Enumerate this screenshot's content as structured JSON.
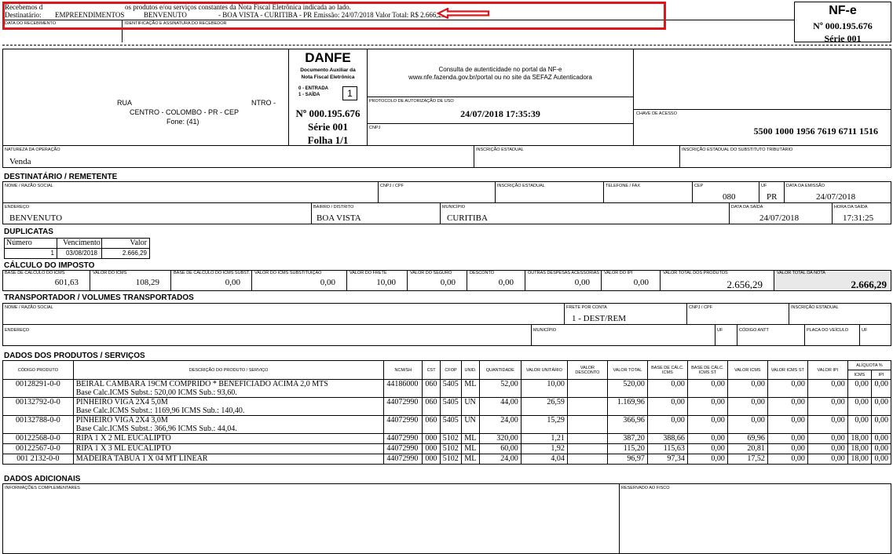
{
  "canhoto": {
    "line1_left": "Recebemos d",
    "line1_right": "os produtos e/ou serviços constantes da Nota Fiscal Eletrônica indicada ao lado.",
    "dest_label": "Destinatário:",
    "dest_name": "EMPREENDIMENTOS",
    "dest_addr": "BENVENUTO",
    "dest_rest": "- BOA VISTA - CURITIBA - PR Emissão: 24/07/2018  Valor Total: R$ 2.666,29",
    "date_label": "DATA DO RECEBIMENTO",
    "sign_label": "IDENTIFICAÇÃO E ASSINATURA DO RECEBEDOR",
    "nfe_title": "NF-e",
    "nfe_number": "Nº 000.195.676",
    "nfe_serie": "Série 001",
    "highlight_color": "#e0151b"
  },
  "emitente": {
    "street": "RUA",
    "district_code": "NTRO -",
    "city_line": "CENTRO - COLOMBO - PR - CEP",
    "phone": "Fone: (41)"
  },
  "danfe": {
    "title": "DANFE",
    "sub1": "Documento Auxiliar da",
    "sub2": "Nota Fiscal Eletrônica",
    "entrada": "0 - ENTRADA",
    "saida": "1 - SAÍDA",
    "tipo": "1",
    "numero": "Nº 000.195.676",
    "serie": "Série 001",
    "folha": "Folha 1/1"
  },
  "consulta": {
    "line1": "Consulta de autenticidade no portal da NF-e",
    "line2": "www.nfe.fazenda.gov.br/portal ou no site da SEFAZ Autenticadora",
    "protocolo_label": "PROTOCOLO DE AUTORIZAÇÃO DE USO",
    "protocolo_value": "24/07/2018 17:35:39",
    "cnpj_label": "CNPJ",
    "chave_label": "CHAVE DE ACESSO",
    "chave_value": "5500 1000 1956 7619 6711 1516"
  },
  "natureza": {
    "label": "NATUREZA DA OPERAÇÃO",
    "value": "Venda",
    "ie_label": "INSCRIÇÃO ESTADUAL",
    "ie_st_label": "INSCRIÇÃO ESTADUAL DO SUBSTITUTO TRIBUTÁRIO"
  },
  "destinatario": {
    "section": "DESTINATÁRIO / REMETENTE",
    "nome_label": "NOME / RAZÃO SOCIAL",
    "cnpj_label": "CNPJ / CPF",
    "ie_label": "INSCRIÇÃO ESTADUAL",
    "fone_label": "TELEFONE / FAX",
    "cep_label": "CEP",
    "cep_value": "080",
    "uf_label": "UF",
    "uf_value": "PR",
    "emissao_label": "DATA DA EMISSÃO",
    "emissao_value": "24/07/2018",
    "endereco_label": "ENDEREÇO",
    "endereco_value": "BENVENUTO",
    "bairro_label": "BAIRRO / DISTRITO",
    "bairro_value": "BOA VISTA",
    "municipio_label": "MUNICÍPIO",
    "municipio_value": "CURITIBA",
    "saida_label": "DATA DA SAÍDA",
    "saida_value": "24/07/2018",
    "hora_label": "HORA DA SAÍDA",
    "hora_value": "17:31:25"
  },
  "duplicatas": {
    "section": "DUPLICATAS",
    "headers": [
      "Número",
      "Vencimento",
      "Valor"
    ],
    "row": [
      "1",
      "03/08/2018",
      "2.666,29"
    ]
  },
  "imposto": {
    "section": "CÁLCULO DO IMPOSTO",
    "fields": [
      {
        "label": "BASE DE CÁLCULO DO ICMS",
        "value": "601,63"
      },
      {
        "label": "VALOR DO ICMS",
        "value": "108,29"
      },
      {
        "label": "BASE DE CÁLCULO DO ICMS SUBST.",
        "value": "0,00"
      },
      {
        "label": "VALOR DO ICMS SUBSTITUIÇÃO",
        "value": "0,00"
      },
      {
        "label": "VALOR DO FRETE",
        "value": "10,00"
      },
      {
        "label": "VALOR DO SEGURO",
        "value": "0,00"
      },
      {
        "label": "DESCONTO",
        "value": "0,00"
      },
      {
        "label": "OUTRAS DESPESAS ACESSÓRIAS",
        "value": "0,00"
      },
      {
        "label": "VALOR DO IPI",
        "value": "0,00"
      },
      {
        "label": "VALOR TOTAL DOS PRODUTOS",
        "value": "2.656,29"
      },
      {
        "label": "VALOR TOTAL DA NOTA",
        "value": "2.666,29"
      }
    ]
  },
  "transportador": {
    "section": "TRANSPORTADOR / VOLUMES TRANSPORTADOS",
    "nome_label": "NOME / RAZÃO SOCIAL",
    "frete_label": "FRETE POR CONTA",
    "frete_value": "1 - DEST/REM",
    "cnpj_label": "CNPJ / CPF",
    "ie_label": "INSCRIÇÃO ESTADUAL",
    "endereco_label": "ENDEREÇO",
    "municipio_label": "MUNICÍPIO",
    "uf_label": "UF",
    "antt_label": "CÓDIGO ANTT",
    "placa_label": "PLACA DO VEÍCULO",
    "uf2_label": "UF"
  },
  "produtos": {
    "section": "DADOS DOS PRODUTOS / SERVIÇOS",
    "headers": [
      "CÓDIGO PRODUTO",
      "DESCRIÇÃO DO PRODUTO / SERVIÇO",
      "NCM/SH",
      "CST",
      "CFOP",
      "UNID.",
      "QUANTIDADE",
      "VALOR UNITÁRIO",
      "VALOR DESCONTO",
      "VALOR TOTAL",
      "BASE DE CÁLC. ICMS",
      "BASE DE CÁLC. ICMS ST",
      "VALOR ICMS",
      "VALOR ICMS ST",
      "VALOR IPI"
    ],
    "aliquota_label": "ALÍQUOTA %",
    "aliquota_icms": "ICMS",
    "aliquota_ipi": "IPI",
    "rows": [
      {
        "codigo": "00128291-0-0",
        "descricao": "BEIRAL CAMBARA 19CM COMPRIDO * BENEFICIADO ACIMA 2,0 MTS",
        "extra": "Base Calc.ICMS Subst.: 520,00 ICMS Sub.: 93,60.",
        "ncm": "44186000",
        "cst": "060",
        "cfop": "5405",
        "unid": "ML",
        "qtd": "52,00",
        "vunit": "10,00",
        "vdesc": "",
        "vtotal": "520,00",
        "bc": "0,00",
        "bcst": "0,00",
        "vicms": "0,00",
        "vicmsst": "0,00",
        "vipi": "0,00",
        "aicms": "0,00",
        "aipi": "0,00"
      },
      {
        "codigo": "00132792-0-0",
        "descricao": "PINHEIRO VIGA 2X4 5,0M",
        "extra": "Base Calc.ICMS Subst.: 1169,96 ICMS Sub.: 140,40.",
        "ncm": "44072990",
        "cst": "060",
        "cfop": "5405",
        "unid": "UN",
        "qtd": "44,00",
        "vunit": "26,59",
        "vdesc": "",
        "vtotal": "1.169,96",
        "bc": "0,00",
        "bcst": "0,00",
        "vicms": "0,00",
        "vicmsst": "0,00",
        "vipi": "0,00",
        "aicms": "0,00",
        "aipi": "0,00"
      },
      {
        "codigo": "00132788-0-0",
        "descricao": "PINHEIRO VIGA 2X4 3,0M",
        "extra": "Base Calc.ICMS Subst.: 366,96 ICMS Sub.: 44,04.",
        "ncm": "44072990",
        "cst": "060",
        "cfop": "5405",
        "unid": "UN",
        "qtd": "24,00",
        "vunit": "15,29",
        "vdesc": "",
        "vtotal": "366,96",
        "bc": "0,00",
        "bcst": "0,00",
        "vicms": "0,00",
        "vicmsst": "0,00",
        "vipi": "0,00",
        "aicms": "0,00",
        "aipi": "0,00"
      },
      {
        "codigo": "00122568-0-0",
        "descricao": "RIPA 1 X 2 ML EUCALIPTO",
        "extra": "",
        "ncm": "44072990",
        "cst": "000",
        "cfop": "5102",
        "unid": "ML",
        "qtd": "320,00",
        "vunit": "1,21",
        "vdesc": "",
        "vtotal": "387,20",
        "bc": "388,66",
        "bcst": "0,00",
        "vicms": "69,96",
        "vicmsst": "0,00",
        "vipi": "0,00",
        "aicms": "18,00",
        "aipi": "0,00"
      },
      {
        "codigo": "00122567-0-0",
        "descricao": "RIPA 1 X 3 ML EUCALIPTO",
        "extra": "",
        "ncm": "44072990",
        "cst": "000",
        "cfop": "5102",
        "unid": "ML",
        "qtd": "60,00",
        "vunit": "1,92",
        "vdesc": "",
        "vtotal": "115,20",
        "bc": "115,63",
        "bcst": "0,00",
        "vicms": "20,81",
        "vicmsst": "0,00",
        "vipi": "0,00",
        "aicms": "18,00",
        "aipi": "0,00"
      },
      {
        "codigo": "001 2132-0-0",
        "descricao": "MADEIRA TABUA 1 X 04 MT LINEAR",
        "extra": "",
        "ncm": "44072990",
        "cst": "000",
        "cfop": "5102",
        "unid": "ML",
        "qtd": "24,00",
        "vunit": "4,04",
        "vdesc": "",
        "vtotal": "96,97",
        "bc": "97,34",
        "bcst": "0,00",
        "vicms": "17,52",
        "vicmsst": "0,00",
        "vipi": "0,00",
        "aicms": "18,00",
        "aipi": "0,00"
      }
    ]
  },
  "adicionais": {
    "section": "DADOS ADICIONAIS",
    "info_label": "INFORMAÇÕES COMPLEMENTARES",
    "fisco_label": "RESERVADO AO FISCO"
  }
}
